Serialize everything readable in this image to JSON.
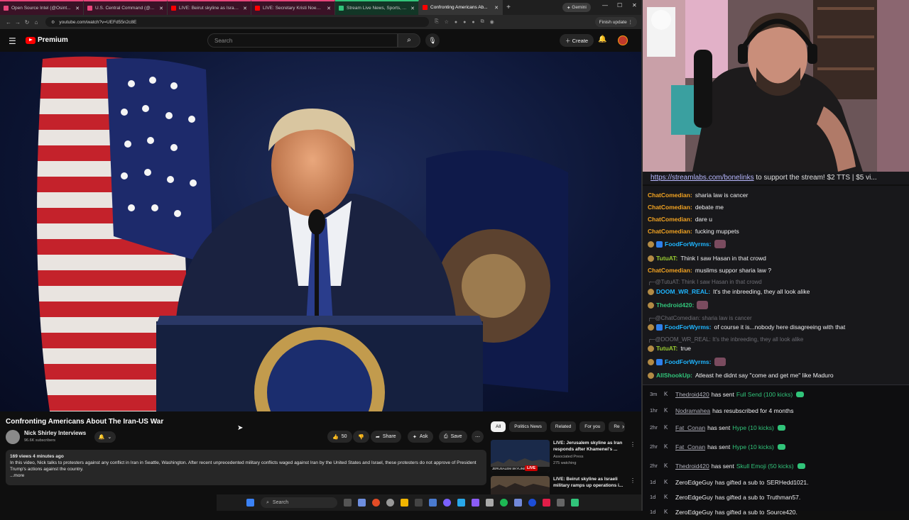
{
  "browser": {
    "tabs": [
      {
        "label": "Open Source Intel (@Osint...",
        "style": "pink",
        "favicon": "#e8457a"
      },
      {
        "label": "U.S. Central Command (@...",
        "style": "pink",
        "favicon": "#e8457a"
      },
      {
        "label": "LIVE: Beirut skyline as Israeli m...",
        "style": "pink",
        "favicon": "#ff0000"
      },
      {
        "label": "LIVE: Secretary Kristi Noem Te...",
        "style": "pink",
        "favicon": "#ff0000"
      },
      {
        "label": "Stream Live News, Sports, ...",
        "style": "green",
        "favicon": "#31c47a"
      },
      {
        "label": "Confronting Americans Ab...",
        "style": "active",
        "favicon": "#ff0000"
      }
    ],
    "gemini_label": "Gemini",
    "url": "youtube.com/watch?v=UEFd55n2c8E",
    "finish_update_label": "Finish update"
  },
  "youtube": {
    "logo_text": "Premium",
    "search_placeholder": "Search",
    "create_label": "Create",
    "video": {
      "title": "Confronting Americans About The Iran-US War",
      "channel_name": "Nick Shirley Interviews",
      "subscribers": "96.6K subscribers",
      "likes": "50",
      "share_label": "Share",
      "ask_label": "Ask",
      "save_label": "Save",
      "meta": "169 views  4 minutes ago",
      "description": "In this video, Nick talks to protesters against any conflict in Iran in Seattle, Washington. After recent unprecedented military conflicts waged against Iran by the United States and Israel, these protesters do not approve of President Trump's actions against the country.",
      "more_label": "...more"
    },
    "chips": [
      "All",
      "Politics News",
      "Related",
      "For you",
      "Re"
    ],
    "recommendations": [
      {
        "title": "LIVE: Jerusalem skyline as Iran responds after Khamenei's ...",
        "channel": "Associated Press",
        "stats": "275 watching",
        "live_badge": "LIVE",
        "thumb_caption": "JERUSALEM SKYLINE"
      },
      {
        "title": "LIVE: Beirut skyline as Israeli military ramps up operations i...",
        "channel": "Associated Press",
        "stats": "",
        "live_badge": "",
        "thumb_caption": ""
      }
    ]
  },
  "stream": {
    "ticker_link": "https://streamlabs.com/bonelinks",
    "ticker_text": " to support the stream! $2 TTS | $5 vi..."
  },
  "chat": [
    {
      "kind": "msg",
      "user": "ChatComedian",
      "color": "#f2a322",
      "badges": 0,
      "text": "sharia law is cancer"
    },
    {
      "kind": "msg",
      "user": "ChatComedian",
      "color": "#f2a322",
      "badges": 0,
      "text": "debate me"
    },
    {
      "kind": "msg",
      "user": "ChatComedian",
      "color": "#f2a322",
      "badges": 0,
      "text": "dare u"
    },
    {
      "kind": "msg",
      "user": "ChatComedian",
      "color": "#f2a322",
      "badges": 0,
      "text": "fucking muppets"
    },
    {
      "kind": "msg",
      "user": "FoodForWyrms",
      "color": "#1fb5ff",
      "badges": 2,
      "text": "",
      "emote": true
    },
    {
      "kind": "msg",
      "user": "TutuAT",
      "color": "#9acd32",
      "badges": 1,
      "text": "Think I saw Hasan in that crowd"
    },
    {
      "kind": "msg",
      "user": "ChatComedian",
      "color": "#f2a322",
      "badges": 0,
      "text": "muslims suppor sharia law ?"
    },
    {
      "kind": "reply",
      "text": "@TutuAT: Think I saw Hasan in that crowd"
    },
    {
      "kind": "msg",
      "user": "DOOM_WR_REAL",
      "color": "#1fb5ff",
      "badges": 1,
      "text": "It's the inbreeding, they all look alike"
    },
    {
      "kind": "msg",
      "user": "Thedroid420",
      "color": "#31c47a",
      "badges": 1,
      "text": "",
      "emote": true
    },
    {
      "kind": "reply",
      "text": "@ChatComedian: sharia law is cancer"
    },
    {
      "kind": "msg",
      "user": "FoodForWyrms",
      "color": "#1fb5ff",
      "badges": 2,
      "text": "of course it is...nobody here disagreeing with that"
    },
    {
      "kind": "reply",
      "text": "@DOOM_WR_REAL: It's the inbreeding, they all look alike"
    },
    {
      "kind": "msg",
      "user": "TutuAT",
      "color": "#9acd32",
      "badges": 1,
      "text": "true"
    },
    {
      "kind": "msg",
      "user": "FoodForWyrms",
      "color": "#1fb5ff",
      "badges": 2,
      "text": "",
      "emote": true
    },
    {
      "kind": "msg",
      "user": "AllShookUp",
      "color": "#31c47a",
      "badges": 1,
      "text": "Atleast he didnt say \"come and get me\" like Maduro"
    }
  ],
  "events": [
    {
      "time": "3m",
      "name": "Thedroid420",
      "action": "has sent",
      "gift": "Full Send (100 kicks)",
      "gem": true
    },
    {
      "time": "1hr",
      "name": "Nodramahea",
      "action": "has resubscribed for 4 months",
      "gift": "",
      "gem": false
    },
    {
      "time": "2hr",
      "name": "Fat_Conan",
      "action": "has sent",
      "gift": "Hype (10 kicks)",
      "gem": true
    },
    {
      "time": "2hr",
      "name": "Fat_Conan",
      "action": "has sent",
      "gift": "Hype (10 kicks)",
      "gem": true
    },
    {
      "time": "2hr",
      "name": "Thedroid420",
      "action": "has sent",
      "gift": "Skull Emoji (50 kicks)",
      "gem": true
    },
    {
      "time": "1d",
      "name": "ZeroEdgeGuy",
      "action": "has gifted a sub to",
      "gift": "SERHedd1021.",
      "gem": false,
      "plain": true
    },
    {
      "time": "1d",
      "name": "ZeroEdgeGuy",
      "action": "has gifted a sub to",
      "gift": "Truthman57.",
      "gem": false,
      "plain": true
    },
    {
      "time": "1d",
      "name": "ZeroEdgeGuy",
      "action": "has gifted a sub to",
      "gift": "Source420.",
      "gem": false,
      "plain": true
    }
  ],
  "taskbar": {
    "search_label": "Search"
  },
  "colors": {
    "youtube_red": "#ff0000",
    "kick_green": "#31c47a",
    "chat_bg": "#18181b"
  }
}
